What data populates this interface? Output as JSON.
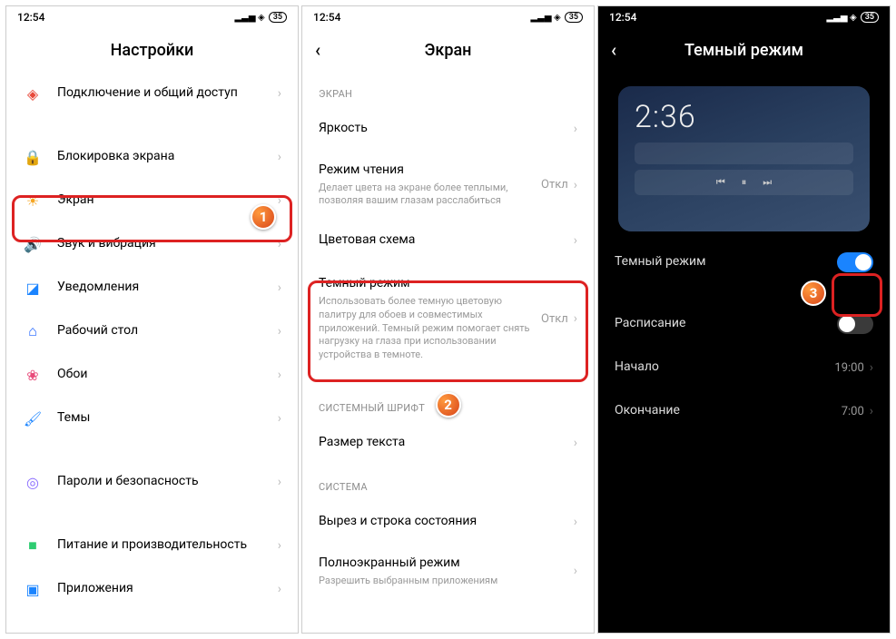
{
  "status": {
    "time": "12:54",
    "battery": "35"
  },
  "screen1": {
    "title": "Настройки",
    "items": [
      {
        "label": "Подключение и общий доступ",
        "iconColor": "#e84a3b"
      },
      {
        "label": "Блокировка экрана",
        "iconColor": "#e84a3b"
      },
      {
        "label": "Экран",
        "iconColor": "#f5a623"
      },
      {
        "label": "Звук и вибрация",
        "iconColor": "#2ecc71"
      },
      {
        "label": "Уведомления",
        "iconColor": "#1a84ff"
      },
      {
        "label": "Рабочий стол",
        "iconColor": "#1a60ff"
      },
      {
        "label": "Обои",
        "iconColor": "#e84a7a"
      },
      {
        "label": "Темы",
        "iconColor": "#1a84ff"
      },
      {
        "label": "Пароли и безопасность",
        "iconColor": "#8a6cff"
      },
      {
        "label": "Питание и производительность",
        "iconColor": "#2ecc71"
      },
      {
        "label": "Приложения",
        "iconColor": "#1a84ff"
      }
    ]
  },
  "screen2": {
    "title": "Экран",
    "sections": {
      "screen_label": "ЭКРАН",
      "font_label": "СИСТЕМНЫЙ ШРИФТ",
      "system_label": "СИСТЕМА"
    },
    "rows": {
      "brightness": "Яркость",
      "reading": {
        "title": "Режим чтения",
        "desc": "Делает цвета на экране более теплыми, позволяя вашим глазам расслабиться",
        "value": "Откл"
      },
      "color_scheme": "Цветовая схема",
      "dark_mode": {
        "title": "Темный режим",
        "desc": "Использовать более темную цветовую палитру для обоев и совместимых приложений. Темный режим помогает снять нагрузку на глаза при использовании устройства в темноте.",
        "value": "Откл"
      },
      "text_size": "Размер текста",
      "notch": "Вырез и строка состояния",
      "fullscreen": {
        "title": "Полноэкранный режим",
        "desc": "Разрешить выбранным приложениям"
      }
    }
  },
  "screen3": {
    "title": "Темный режим",
    "preview_time": "2:36",
    "dark_mode_label": "Темный режим",
    "schedule_label": "Расписание",
    "start_label": "Начало",
    "start_value": "19:00",
    "end_label": "Окончание",
    "end_value": "7:00"
  },
  "annotations": {
    "b1": "1",
    "b2": "2",
    "b3": "3"
  }
}
